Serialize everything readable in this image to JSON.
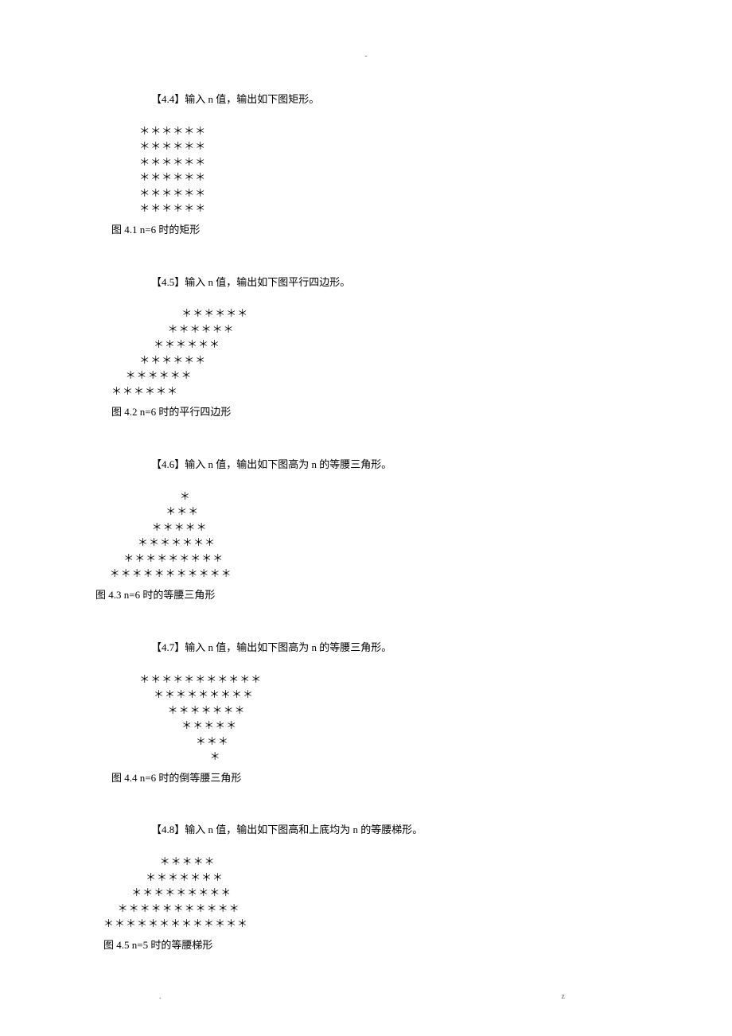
{
  "header_mark": "-",
  "problems": [
    {
      "title": "【4.4】输入 n 值，输出如下图矩形。",
      "shape": [
        "    ＊＊＊＊＊＊",
        "    ＊＊＊＊＊＊",
        "    ＊＊＊＊＊＊",
        "    ＊＊＊＊＊＊",
        "    ＊＊＊＊＊＊",
        "    ＊＊＊＊＊＊"
      ],
      "caption": "图 4.1   n=6 时的矩形"
    },
    {
      "title": "【4.5】输入 n 值，输出如下图平行四边形。",
      "shape": [
        "          ＊＊＊＊＊＊",
        "        ＊＊＊＊＊＊",
        "      ＊＊＊＊＊＊",
        "    ＊＊＊＊＊＊",
        "  ＊＊＊＊＊＊",
        "＊＊＊＊＊＊"
      ],
      "caption": "图 4.2   n=6 时的平行四边形"
    },
    {
      "title": "【4.6】输入 n 值，输出如下图高为 n 的等腰三角形。",
      "shape": [
        "            ＊",
        "          ＊＊＊",
        "        ＊＊＊＊＊",
        "      ＊＊＊＊＊＊＊",
        "    ＊＊＊＊＊＊＊＊＊",
        "  ＊＊＊＊＊＊＊＊＊＊＊"
      ],
      "caption": "图 4.3   n=6 时的等腰三角形"
    },
    {
      "title": "【4.7】输入 n 值，输出如下图高为 n 的等腰三角形。",
      "shape": [
        "    ＊＊＊＊＊＊＊＊＊＊＊",
        "      ＊＊＊＊＊＊＊＊＊",
        "        ＊＊＊＊＊＊＊",
        "          ＊＊＊＊＊",
        "            ＊＊＊",
        "              ＊"
      ],
      "caption": "图 4.4   n=6 时的倒等腰三角形"
    },
    {
      "title": "【4.8】输入 n 值，输出如下图高和上底均为 n 的等腰梯形。",
      "shape": [
        "        ＊＊＊＊＊",
        "      ＊＊＊＊＊＊＊",
        "    ＊＊＊＊＊＊＊＊＊",
        "  ＊＊＊＊＊＊＊＊＊＊＊",
        "＊＊＊＊＊＊＊＊＊＊＊＊＊"
      ],
      "caption": "  图 4.5 n=5 时的等腰梯形"
    }
  ],
  "footer": {
    "left": ".",
    "right": "z"
  }
}
